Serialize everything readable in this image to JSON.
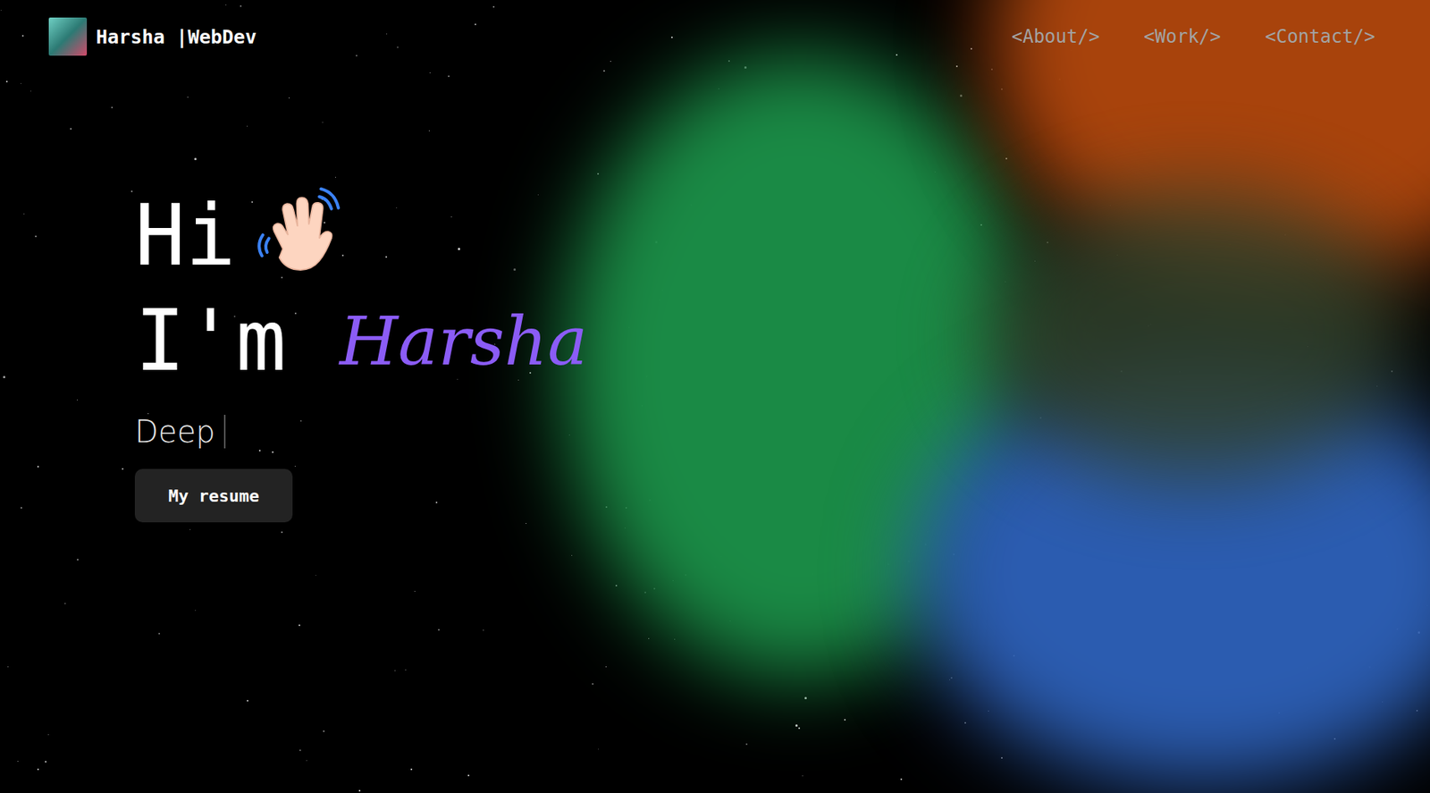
{
  "header": {
    "logo": {
      "alt": "photo"
    },
    "brand": "Harsha |WebDev",
    "links": [
      "<About/>",
      "<Work/>",
      "<Contact/>"
    ]
  },
  "hero": {
    "greeting": "Hi",
    "intro": "I'm",
    "name": "Harsha",
    "typed": "Deep",
    "button": "My resume"
  }
}
